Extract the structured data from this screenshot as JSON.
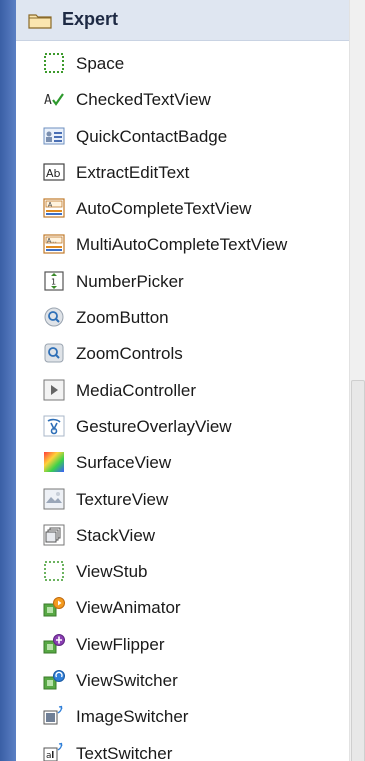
{
  "palette": {
    "section": {
      "label": "Expert",
      "icon": "folder-icon"
    },
    "items": [
      {
        "label": "Space",
        "icon": "space-icon"
      },
      {
        "label": "CheckedTextView",
        "icon": "checked-text-view-icon"
      },
      {
        "label": "QuickContactBadge",
        "icon": "quick-contact-badge-icon"
      },
      {
        "label": "ExtractEditText",
        "icon": "extract-edit-text-icon"
      },
      {
        "label": "AutoCompleteTextView",
        "icon": "autocomplete-icon"
      },
      {
        "label": "MultiAutoCompleteTextView",
        "icon": "multi-autocomplete-icon"
      },
      {
        "label": "NumberPicker",
        "icon": "number-picker-icon"
      },
      {
        "label": "ZoomButton",
        "icon": "zoom-button-icon"
      },
      {
        "label": "ZoomControls",
        "icon": "zoom-controls-icon"
      },
      {
        "label": "MediaController",
        "icon": "media-controller-icon"
      },
      {
        "label": "GestureOverlayView",
        "icon": "gesture-overlay-icon"
      },
      {
        "label": "SurfaceView",
        "icon": "surface-view-icon"
      },
      {
        "label": "TextureView",
        "icon": "texture-view-icon"
      },
      {
        "label": "StackView",
        "icon": "stack-view-icon"
      },
      {
        "label": "ViewStub",
        "icon": "view-stub-icon"
      },
      {
        "label": "ViewAnimator",
        "icon": "view-animator-icon"
      },
      {
        "label": "ViewFlipper",
        "icon": "view-flipper-icon"
      },
      {
        "label": "ViewSwitcher",
        "icon": "view-switcher-icon"
      },
      {
        "label": "ImageSwitcher",
        "icon": "image-switcher-icon"
      },
      {
        "label": "TextSwitcher",
        "icon": "text-switcher-icon"
      }
    ]
  }
}
